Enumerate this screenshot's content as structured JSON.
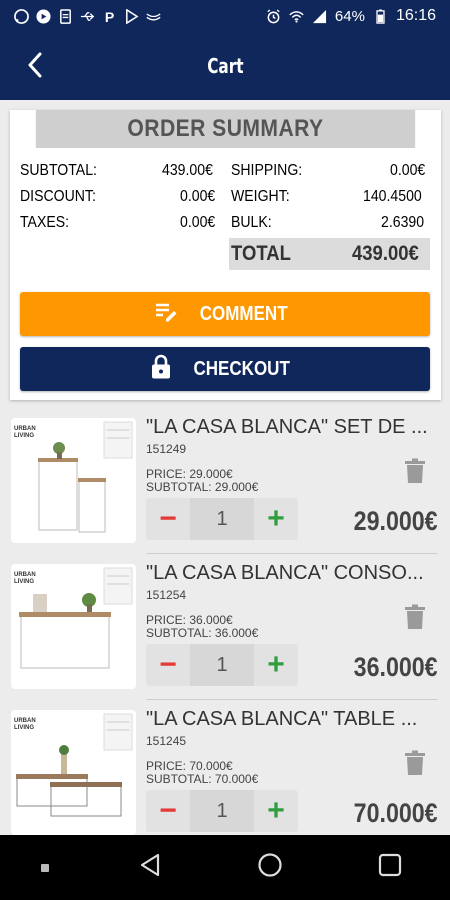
{
  "status": {
    "battery": "64%",
    "time": "16:16"
  },
  "header": {
    "title": "Cart"
  },
  "summary": {
    "title": "ORDER SUMMARY",
    "subtotal_label": "SUBTOTAL:",
    "subtotal": "439.00€",
    "discount_label": "DISCOUNT:",
    "discount": "0.00€",
    "taxes_label": "TAXES:",
    "taxes": "0.00€",
    "shipping_label": "SHIPPING:",
    "shipping": "0.00€",
    "weight_label": "WEIGHT:",
    "weight": "140.4500",
    "bulk_label": "BULK:",
    "bulk": "2.6390",
    "total_label": "TOTAL",
    "total": "439.00€"
  },
  "buttons": {
    "comment": "COMMENT",
    "checkout": "CHECKOUT"
  },
  "items": [
    {
      "name": "\"LA CASA BLANCA\" SET DE ...",
      "ref": "151249",
      "price": "PRICE: 29.000€",
      "subtotal": "SUBTOTAL: 29.000€",
      "qty": "1",
      "total": "29.000€"
    },
    {
      "name": "\"LA CASA BLANCA\" CONSO...",
      "ref": "151254",
      "price": "PRICE: 36.000€",
      "subtotal": "SUBTOTAL: 36.000€",
      "qty": "1",
      "total": "36.000€"
    },
    {
      "name": "\"LA CASA BLANCA\" TABLE ...",
      "ref": "151245",
      "price": "PRICE: 70.000€",
      "subtotal": "SUBTOTAL: 70.000€",
      "qty": "1",
      "total": "70.000€"
    }
  ],
  "stepper": {
    "minus": "−",
    "plus": "+"
  },
  "thumb_brand": "URBAN LIVING",
  "colors": {
    "primary": "#10275c",
    "accent": "#ff9800",
    "minus": "#e53935",
    "plus": "#2e9e3e"
  },
  "icons": [
    "whatsapp-icon",
    "youtube-icon",
    "doc-icon",
    "usb-icon",
    "parking-icon",
    "play-store-icon",
    "mail-icon",
    "alarm-icon",
    "wifi-icon",
    "signal-icon",
    "battery-icon",
    "back-arrow-icon",
    "comment-edit-icon",
    "lock-icon",
    "trash-icon",
    "nav-back-icon",
    "nav-home-icon",
    "nav-recents-icon"
  ]
}
